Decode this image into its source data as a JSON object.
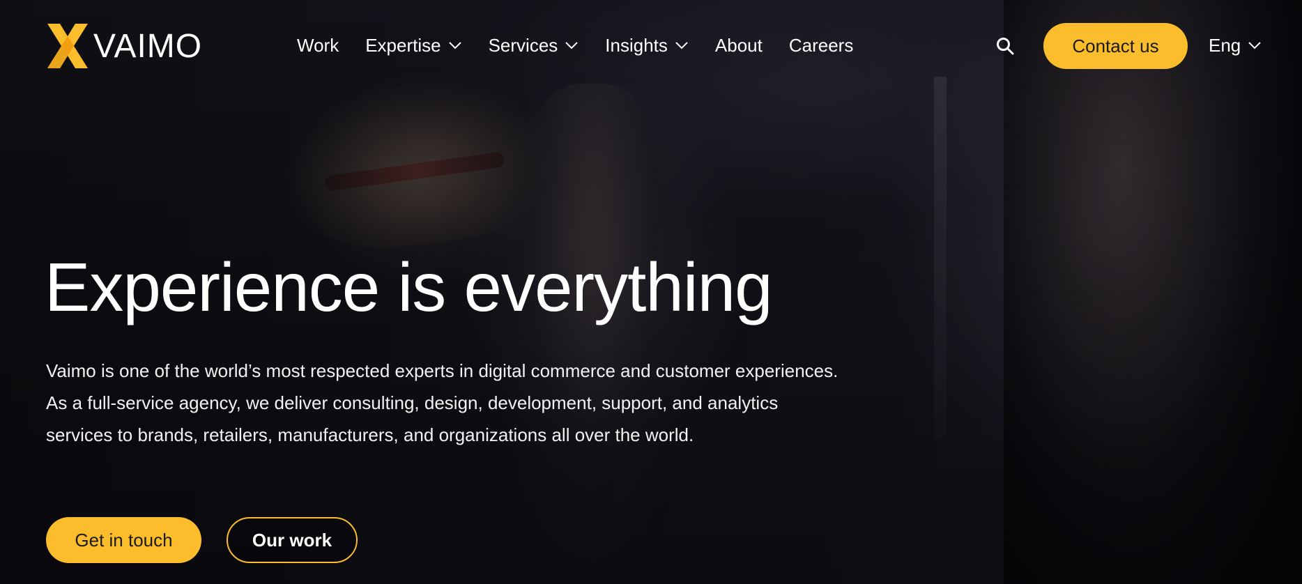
{
  "brand": {
    "name": "VAIMO",
    "accent_color": "#fbbd2b",
    "logo_icon": "vaimo-x-logo-icon"
  },
  "nav": {
    "items": [
      {
        "label": "Work",
        "has_dropdown": false
      },
      {
        "label": "Expertise",
        "has_dropdown": true
      },
      {
        "label": "Services",
        "has_dropdown": true
      },
      {
        "label": "Insights",
        "has_dropdown": true
      },
      {
        "label": "About",
        "has_dropdown": false
      },
      {
        "label": "Careers",
        "has_dropdown": false
      }
    ],
    "search_icon": "search-icon",
    "contact_label": "Contact us",
    "language_label": "Eng"
  },
  "hero": {
    "headline": "Experience is everything",
    "intro": "Vaimo is one of the world’s most respected experts in digital commerce and customer experiences. As a full-service agency, we deliver consulting, design, development, support, and analytics services to brands, retailers, manufacturers, and organizations all over the world.",
    "primary_cta": "Get in touch",
    "secondary_cta": "Our work"
  }
}
